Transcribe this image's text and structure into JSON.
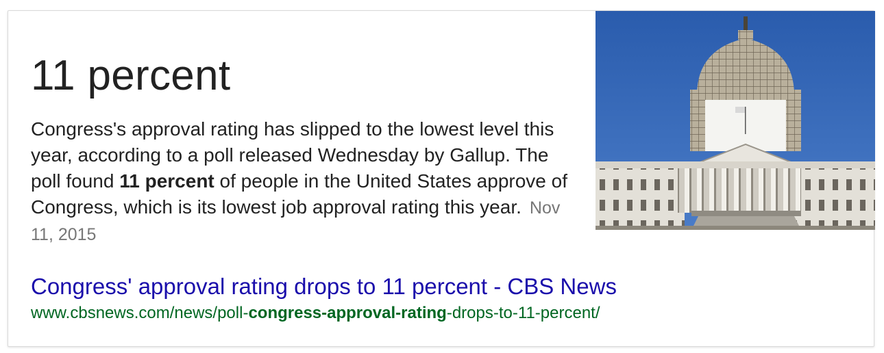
{
  "answer": {
    "title": "11 percent",
    "snippet_before": "Congress's approval rating has slipped to the lowest level this year, according to a poll released Wednesday by Gallup. The poll found ",
    "snippet_bold": "11 percent",
    "snippet_after": " of people in the United States approve of Congress, which is its lowest job approval rating this year.",
    "date": "Nov 11, 2015"
  },
  "image": {
    "subject": "us-capitol-dome-scaffolding"
  },
  "result": {
    "title": "Congress' approval rating drops to 11 percent - CBS News",
    "url_prefix": "www.cbsnews.com/news/poll-",
    "url_bold": "congress-approval-rating",
    "url_suffix": "-drops-to-11-percent/"
  },
  "colors": {
    "link": "#1a0dab",
    "url": "#006621",
    "sky": "#2d62b5"
  }
}
